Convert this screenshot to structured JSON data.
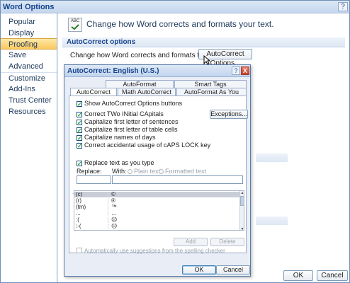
{
  "window": {
    "title": "Word Options",
    "help_label": "?",
    "ok_label": "OK",
    "cancel_label": "Cancel"
  },
  "nav": {
    "items": [
      {
        "label": "Popular"
      },
      {
        "label": "Display"
      },
      {
        "label": "Proofing"
      },
      {
        "label": "Save"
      },
      {
        "label": "Advanced"
      },
      {
        "label": "Customize"
      },
      {
        "label": "Add-Ins"
      },
      {
        "label": "Trust Center"
      },
      {
        "label": "Resources"
      }
    ],
    "active_index": 2
  },
  "content": {
    "header": "Change how Word corrects and formats your text.",
    "header_icon_text": "ABC",
    "section_title": "AutoCorrect options",
    "autocorrect_prompt": "Change how Word corrects and formats text as you type:",
    "autocorrect_button": "AutoCorrect Options..."
  },
  "dialog": {
    "title": "AutoCorrect: English (U.S.)",
    "help_label": "?",
    "close_label": "X",
    "tabs_top": [
      "AutoFormat",
      "Smart Tags"
    ],
    "tabs_bottom": [
      "AutoCorrect",
      "Math AutoCorrect",
      "AutoFormat As You Type"
    ],
    "active_tab": "AutoCorrect",
    "checkboxes": [
      {
        "label": "Show AutoCorrect Options buttons",
        "checked": true
      },
      {
        "label": "Correct TWo INitial CApitals",
        "checked": true
      },
      {
        "label": "Capitalize first letter of sentences",
        "checked": true
      },
      {
        "label": "Capitalize first letter of table cells",
        "checked": true
      },
      {
        "label": "Capitalize names of days",
        "checked": true
      },
      {
        "label": "Correct accidental usage of cAPS LOCK key",
        "checked": true
      }
    ],
    "exceptions_button": "Exceptions...",
    "replace_checkbox": {
      "label": "Replace text as you type",
      "checked": true
    },
    "replace_label": "Replace:",
    "with_label": "With:",
    "plain_text": "Plain text",
    "formatted_text": "Formatted text",
    "replace_value": "",
    "with_value": "",
    "entries": [
      {
        "from": "(c)",
        "to": "©"
      },
      {
        "from": "(r)",
        "to": "®"
      },
      {
        "from": "(tm)",
        "to": "™"
      },
      {
        "from": "...",
        "to": "…"
      },
      {
        "from": ":(",
        "to": "☹"
      },
      {
        "from": ":-(",
        "to": "☹"
      }
    ],
    "add_button": "Add",
    "delete_button": "Delete",
    "auto_suggest": {
      "label": "Automatically use suggestions from the spelling checker",
      "checked": false
    },
    "ok_label": "OK",
    "cancel_label": "Cancel"
  }
}
